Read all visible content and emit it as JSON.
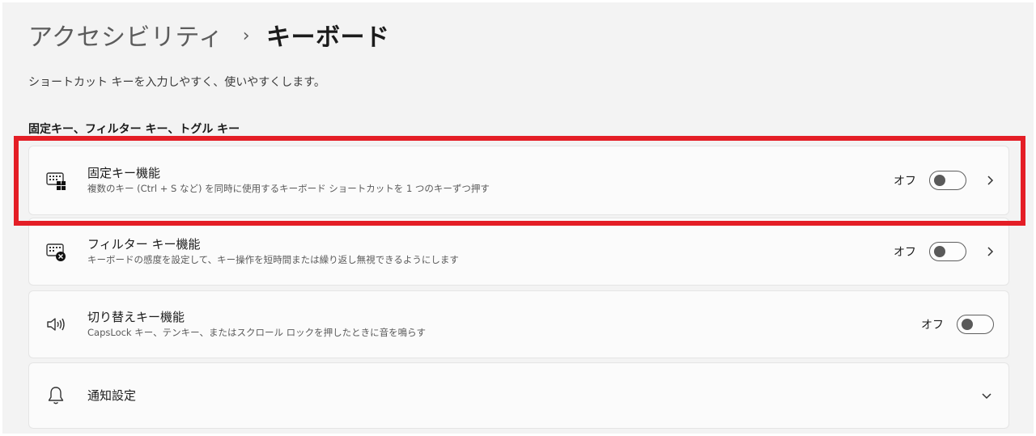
{
  "header": {
    "breadcrumb_parent": "アクセシビリティ",
    "breadcrumb_separator": "›",
    "breadcrumb_current": "キーボード",
    "subtitle": "ショートカット キーを入力しやすく、使いやすくします。"
  },
  "section": {
    "title": "固定キー、フィルター キー、トグル キー"
  },
  "settings": [
    {
      "title": "固定キー機能",
      "description": "複数のキー (Ctrl + S など) を同時に使用するキーボード ショートカットを 1 つのキーずつ押す",
      "state_label": "オフ",
      "icon": "sticky-keys-icon"
    },
    {
      "title": "フィルター キー機能",
      "description": "キーボードの感度を設定して、キー操作を短時間または繰り返し無視できるようにします",
      "state_label": "オフ",
      "icon": "filter-keys-icon"
    },
    {
      "title": "切り替えキー機能",
      "description": "CapsLock キー、テンキー、またはスクロール ロックを押したときに音を鳴らす",
      "state_label": "オフ",
      "icon": "speaker-icon"
    }
  ],
  "notification": {
    "title": "通知設定",
    "icon": "bell-icon"
  },
  "colors": {
    "highlight": "#e41e26",
    "background": "#f3f3f3",
    "card": "#fbfbfb"
  }
}
